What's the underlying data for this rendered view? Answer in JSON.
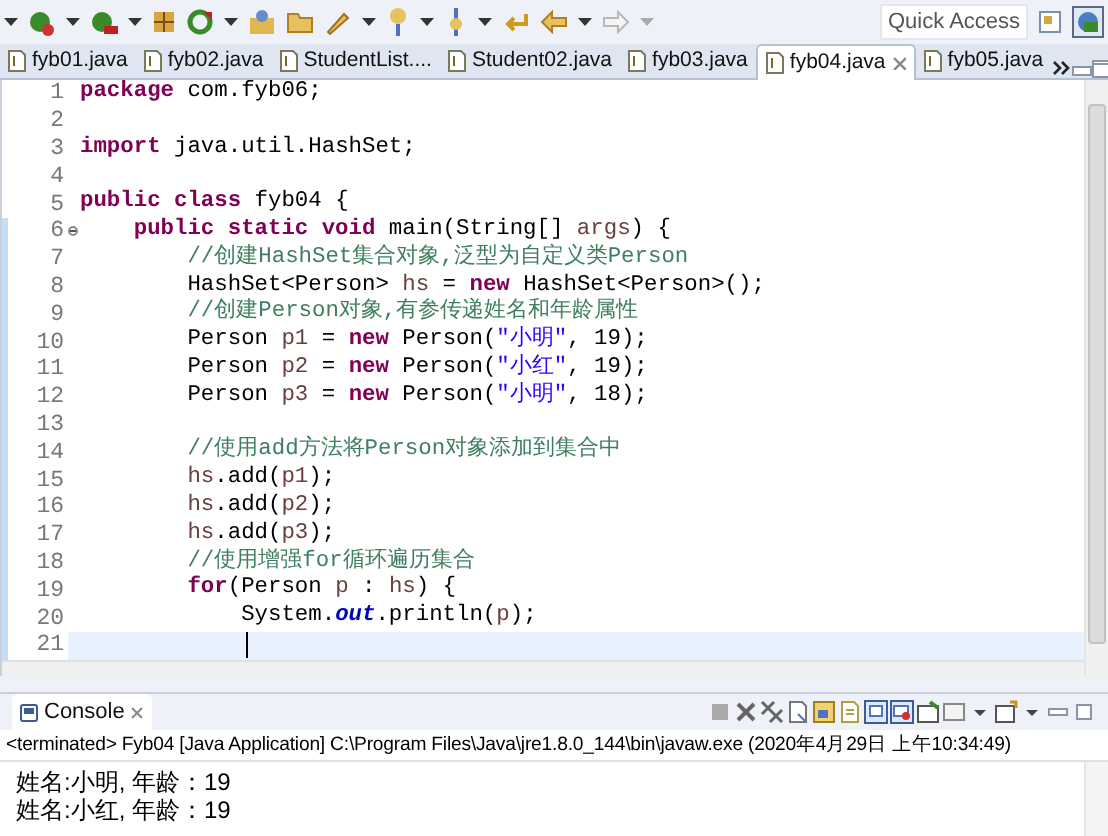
{
  "toolbar": {
    "quick_access": {
      "placeholder": "Quick Access"
    }
  },
  "tabs": [
    {
      "label": "fyb01.java",
      "selected": false
    },
    {
      "label": "fyb02.java",
      "selected": false
    },
    {
      "label": "StudentList....",
      "selected": false
    },
    {
      "label": "Student02.java",
      "selected": false
    },
    {
      "label": "fyb03.java",
      "selected": false
    },
    {
      "label": "fyb04.java",
      "selected": true
    },
    {
      "label": "fyb05.java",
      "selected": false
    }
  ],
  "editor": {
    "lines": [
      {
        "number": "1",
        "tokens": [
          {
            "kind": "kw",
            "text": "package "
          },
          {
            "kind": "plain",
            "text": "com.fyb06;"
          }
        ]
      },
      {
        "number": "2"
      },
      {
        "number": "3",
        "tokens": [
          {
            "kind": "kw",
            "text": "import "
          },
          {
            "kind": "plain",
            "text": "java.util.HashSet;"
          }
        ]
      },
      {
        "number": "4"
      },
      {
        "number": "5",
        "tokens": [
          {
            "kind": "kw",
            "text": "public class "
          },
          {
            "kind": "plain",
            "text": "fyb04 {"
          }
        ]
      },
      {
        "number": "6",
        "fold": true,
        "tokens": [
          {
            "kind": "kw",
            "text": "    public static void "
          },
          {
            "kind": "plain",
            "text": "main(String[] "
          },
          {
            "kind": "var",
            "text": "args"
          },
          {
            "kind": "plain",
            "text": ") {"
          }
        ]
      },
      {
        "number": "7",
        "tokens": [
          {
            "kind": "comment",
            "text": "        //创建HashSet集合对象,泛型为自定义类Person"
          }
        ]
      },
      {
        "number": "8",
        "tokens": [
          {
            "kind": "plain",
            "text": "        HashSet<Person> "
          },
          {
            "kind": "var",
            "text": "hs"
          },
          {
            "kind": "plain",
            "text": " = "
          },
          {
            "kind": "kw",
            "text": "new "
          },
          {
            "kind": "plain",
            "text": "HashSet<Person>();"
          }
        ]
      },
      {
        "number": "9",
        "tokens": [
          {
            "kind": "comment",
            "text": "        //创建Person对象,有参传递姓名和年龄属性"
          }
        ]
      },
      {
        "number": "10",
        "tokens": [
          {
            "kind": "plain",
            "text": "        Person "
          },
          {
            "kind": "var",
            "text": "p1"
          },
          {
            "kind": "plain",
            "text": " = "
          },
          {
            "kind": "kw",
            "text": "new "
          },
          {
            "kind": "plain",
            "text": "Person("
          },
          {
            "kind": "string",
            "text": "\"小明\""
          },
          {
            "kind": "plain",
            "text": ", 19);"
          }
        ]
      },
      {
        "number": "11",
        "tokens": [
          {
            "kind": "plain",
            "text": "        Person "
          },
          {
            "kind": "var",
            "text": "p2"
          },
          {
            "kind": "plain",
            "text": " = "
          },
          {
            "kind": "kw",
            "text": "new "
          },
          {
            "kind": "plain",
            "text": "Person("
          },
          {
            "kind": "string",
            "text": "\"小红\""
          },
          {
            "kind": "plain",
            "text": ", 19);"
          }
        ]
      },
      {
        "number": "12",
        "tokens": [
          {
            "kind": "plain",
            "text": "        Person "
          },
          {
            "kind": "var",
            "text": "p3"
          },
          {
            "kind": "plain",
            "text": " = "
          },
          {
            "kind": "kw",
            "text": "new "
          },
          {
            "kind": "plain",
            "text": "Person("
          },
          {
            "kind": "string",
            "text": "\"小明\""
          },
          {
            "kind": "plain",
            "text": ", 18);"
          }
        ]
      },
      {
        "number": "13"
      },
      {
        "number": "14",
        "tokens": [
          {
            "kind": "comment",
            "text": "        //使用add方法将Person对象添加到集合中"
          }
        ]
      },
      {
        "number": "15",
        "tokens": [
          {
            "kind": "var",
            "text": "        hs"
          },
          {
            "kind": "plain",
            "text": ".add("
          },
          {
            "kind": "var",
            "text": "p1"
          },
          {
            "kind": "plain",
            "text": ");"
          }
        ]
      },
      {
        "number": "16",
        "tokens": [
          {
            "kind": "var",
            "text": "        hs"
          },
          {
            "kind": "plain",
            "text": ".add("
          },
          {
            "kind": "var",
            "text": "p2"
          },
          {
            "kind": "plain",
            "text": ");"
          }
        ]
      },
      {
        "number": "17",
        "tokens": [
          {
            "kind": "var",
            "text": "        hs"
          },
          {
            "kind": "plain",
            "text": ".add("
          },
          {
            "kind": "var",
            "text": "p3"
          },
          {
            "kind": "plain",
            "text": ");"
          }
        ]
      },
      {
        "number": "18",
        "tokens": [
          {
            "kind": "comment",
            "text": "        //使用增强for循环遍历集合"
          }
        ]
      },
      {
        "number": "19",
        "tokens": [
          {
            "kind": "kw",
            "text": "        for"
          },
          {
            "kind": "plain",
            "text": "(Person "
          },
          {
            "kind": "var",
            "text": "p"
          },
          {
            "kind": "plain",
            "text": " : "
          },
          {
            "kind": "var",
            "text": "hs"
          },
          {
            "kind": "plain",
            "text": ") {"
          }
        ]
      },
      {
        "number": "20",
        "tokens": [
          {
            "kind": "plain",
            "text": "            System."
          },
          {
            "kind": "field",
            "text": "out"
          },
          {
            "kind": "plain",
            "text": ".println("
          },
          {
            "kind": "var",
            "text": "p"
          },
          {
            "kind": "plain",
            "text": ");"
          }
        ]
      },
      {
        "number": "21",
        "current": true
      }
    ]
  },
  "console": {
    "tab": "Console",
    "status": "<terminated> Fyb04 [Java Application] C:\\Program Files\\Java\\jre1.8.0_144\\bin\\javaw.exe (2020年4月29日 上午10:34:49)",
    "output": [
      "姓名:小明, 年龄：19",
      "姓名:小红, 年龄：19"
    ]
  }
}
